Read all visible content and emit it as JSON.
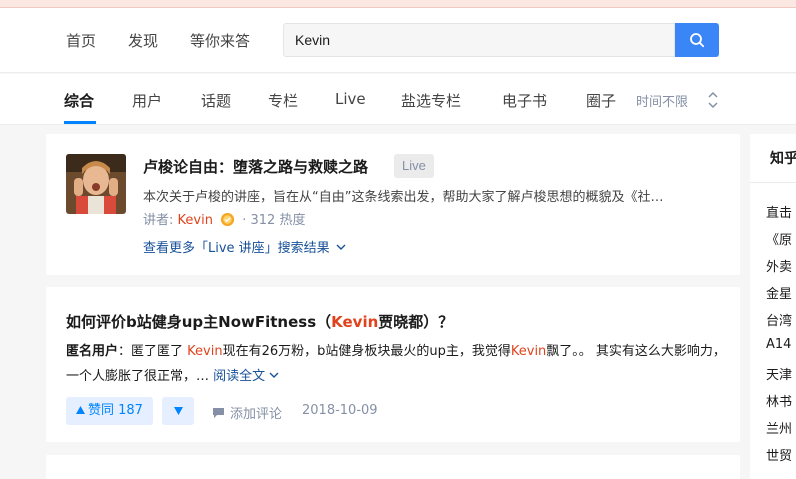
{
  "header": {
    "nav": [
      "首页",
      "发现",
      "等你来答"
    ],
    "search_value": "Kevin"
  },
  "tabs": [
    "综合",
    "用户",
    "话题",
    "专栏",
    "Live",
    "盐选专栏",
    "电子书",
    "圈子"
  ],
  "time_filter": "时间不限",
  "live_card": {
    "title": "卢梭论自由：堕落之路与救赎之路",
    "badge": "Live",
    "desc": "本次关于卢梭的讲座，旨在从“自由”这条线索出发，帮助大家了解卢梭思想的概貌及《社…",
    "speaker_label": "讲者:",
    "speaker": "Kevin",
    "heat": "· 312 热度",
    "more": "查看更多「Live 讲座」搜索结果"
  },
  "question_card": {
    "title_before": "如何评价b站健身up主NowFitness（",
    "title_hl": "Kevin",
    "title_after": "贾晓都）？",
    "author": "匿名用户",
    "answer_a": "：匿了匿了 ",
    "answer_hl1": "Kevin",
    "answer_b": "现在有26万粉，b站健身板块最火的up主，我觉得",
    "answer_hl2": "Kevin",
    "answer_c": "飘了。。 其实有这么大影响力，一个人膨胀了很正常，…",
    "read_more": "阅读全文",
    "vote": "赞同 187",
    "comment": "添加评论",
    "date": "2018-10-09"
  },
  "sidebar": {
    "title": "知乎",
    "items": [
      "直击",
      "《原",
      "外卖",
      "金星",
      "台湾",
      "A14",
      "天津",
      "林书",
      "兰州",
      "世贸"
    ]
  },
  "colors": {
    "accent": "#0084ff",
    "highlight": "#e0431c",
    "link": "#175199"
  }
}
